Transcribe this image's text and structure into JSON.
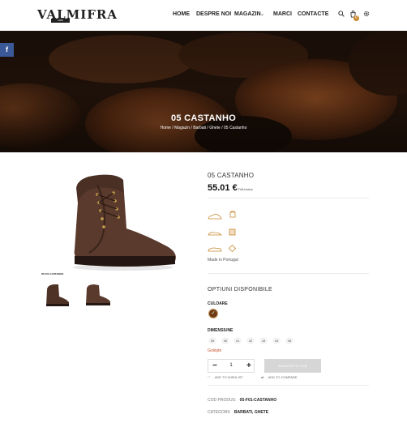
{
  "header": {
    "logo": "VALMIFRA",
    "logo_sub": "1946",
    "nav": [
      "HOME",
      "DESPRE NOI",
      "MAGAZIN",
      "MARCI",
      "CONTACTE"
    ],
    "cart_count": "0"
  },
  "hero": {
    "title": "05 CASTANHO",
    "breadcrumb": "Home / Magazin / Barbati / Ghete / 05 Castanho"
  },
  "social": {
    "facebook": "f"
  },
  "gallery": {
    "caption": "05-F01-CASTANHO"
  },
  "product": {
    "name": "05 CASTANHO",
    "price": "55.01 €",
    "vat": "TVA inclus",
    "made_in": "Made in Portugal"
  },
  "options": {
    "title": "OPTIUNI DISPONIBILE",
    "color_label": "CULOARE",
    "size_label": "DIMENSIUNE",
    "sizes": [
      "39",
      "40",
      "41",
      "42",
      "43",
      "44",
      "45"
    ],
    "clear": "Goleşte",
    "quantity": "1",
    "add_to_cart": "ADAUGĂ ÎN COŞ",
    "wishlist": "ADD TO WISHLIST",
    "compare": "ADD TO COMPARE"
  },
  "meta": {
    "sku_label": "COD PRODUS:",
    "sku": "05-F01-CASTANHO",
    "category_label": "CATEGORII:",
    "categories": "BARBATI, GHETE"
  },
  "colors": {
    "accent": "#c9882e",
    "swatch": "#6e3a14",
    "button": "#d6d6d6",
    "facebook": "#3b5998"
  }
}
